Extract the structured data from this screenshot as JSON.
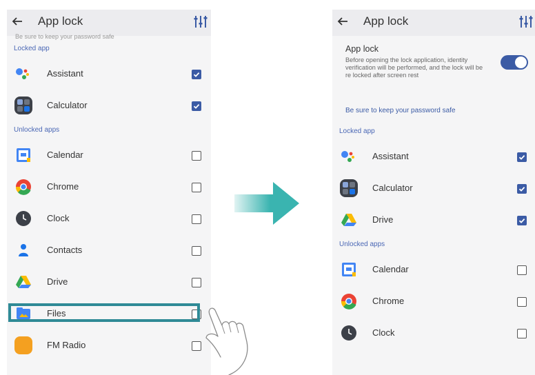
{
  "left": {
    "title": "App lock",
    "cut_hint": "Be sure to keep your password safe",
    "locked_header": "Locked app",
    "locked": [
      {
        "label": "Assistant",
        "checked": true,
        "icon": "assistant-icon"
      },
      {
        "label": "Calculator",
        "checked": true,
        "icon": "calculator-icon"
      }
    ],
    "unlocked_header": "Unlocked apps",
    "unlocked": [
      {
        "label": "Calendar",
        "checked": false,
        "icon": "calendar-icon"
      },
      {
        "label": "Chrome",
        "checked": false,
        "icon": "chrome-icon"
      },
      {
        "label": "Clock",
        "checked": false,
        "icon": "clock-icon"
      },
      {
        "label": "Contacts",
        "checked": false,
        "icon": "contacts-icon"
      },
      {
        "label": "Drive",
        "checked": false,
        "icon": "drive-icon"
      },
      {
        "label": "Files",
        "checked": false,
        "icon": "files-icon"
      },
      {
        "label": "FM Radio",
        "checked": false,
        "icon": "fm-radio-icon"
      }
    ]
  },
  "right": {
    "title": "App lock",
    "app_lock_title": "App lock",
    "app_lock_desc": "Before opening the lock application, identity verification will be performed, and the lock will be re locked after screen rest",
    "toggle_on": true,
    "hint": "Be sure to keep your password safe",
    "locked_header": "Locked app",
    "locked": [
      {
        "label": "Assistant",
        "checked": true,
        "icon": "assistant-icon"
      },
      {
        "label": "Calculator",
        "checked": true,
        "icon": "calculator-icon"
      },
      {
        "label": "Drive",
        "checked": true,
        "icon": "drive-icon"
      }
    ],
    "unlocked_header": "Unlocked apps",
    "unlocked": [
      {
        "label": "Calendar",
        "checked": false,
        "icon": "calendar-icon"
      },
      {
        "label": "Chrome",
        "checked": false,
        "icon": "chrome-icon"
      },
      {
        "label": "Clock",
        "checked": false,
        "icon": "clock-icon"
      }
    ]
  },
  "colors": {
    "accent": "#3b5ba5",
    "arrow": "#3ab4b0",
    "highlight": "#2f8a96"
  }
}
